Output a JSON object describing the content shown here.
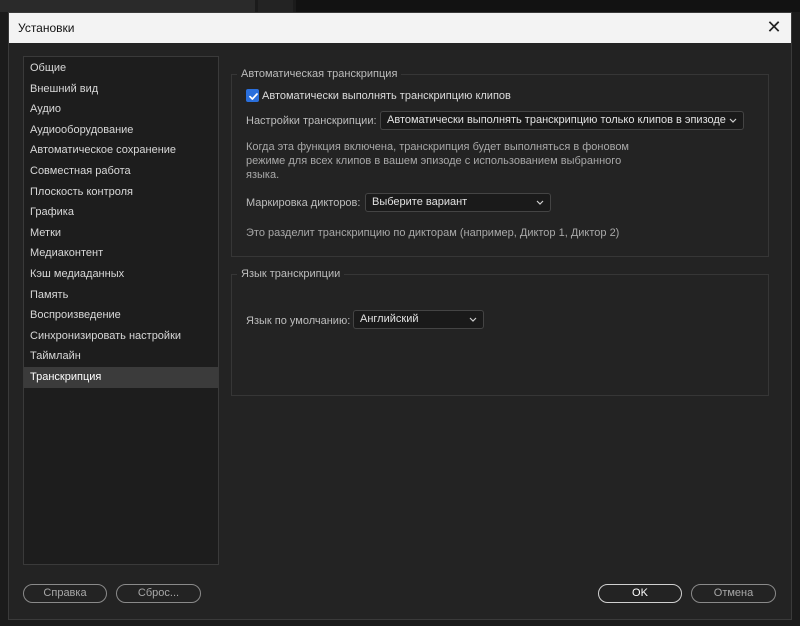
{
  "dialog": {
    "title": "Установки"
  },
  "sidebar": {
    "items": [
      {
        "label": "Общие",
        "selected": false
      },
      {
        "label": "Внешний вид",
        "selected": false
      },
      {
        "label": "Аудио",
        "selected": false
      },
      {
        "label": "Аудиооборудование",
        "selected": false
      },
      {
        "label": "Автоматическое сохранение",
        "selected": false
      },
      {
        "label": "Совместная работа",
        "selected": false
      },
      {
        "label": "Плоскость контроля",
        "selected": false
      },
      {
        "label": "Графика",
        "selected": false
      },
      {
        "label": "Метки",
        "selected": false
      },
      {
        "label": "Медиаконтент",
        "selected": false
      },
      {
        "label": "Кэш медиаданных",
        "selected": false
      },
      {
        "label": "Память",
        "selected": false
      },
      {
        "label": "Воспроизведение",
        "selected": false
      },
      {
        "label": "Синхронизировать настройки",
        "selected": false
      },
      {
        "label": "Таймлайн",
        "selected": false
      },
      {
        "label": "Транскрипция",
        "selected": true
      }
    ]
  },
  "auto_transcription": {
    "group_title": "Автоматическая транскрипция",
    "auto_checkbox_label": "Автоматически выполнять транскрипцию клипов",
    "auto_checkbox_checked": true,
    "settings_label": "Настройки транскрипции:",
    "settings_value": "Автоматически выполнять транскрипцию только клипов в эпизоде",
    "description_lines": [
      "Когда эта функция включена, транскрипция будет выполняться в фоновом",
      "режиме для всех клипов в вашем эпизоде с использованием выбранного",
      "языка."
    ],
    "speaker_label": "Маркировка дикторов:",
    "speaker_value": "Выберите вариант",
    "speaker_hint": "Это разделит транскрипцию по дикторам (например, Диктор 1, Диктор 2)"
  },
  "language": {
    "group_title": "Язык транскрипции",
    "default_label": "Язык по умолчанию:",
    "default_value": "Английский"
  },
  "buttons": {
    "help": "Справка",
    "reset": "Сброс...",
    "ok": "OK",
    "cancel": "Отмена"
  },
  "colors": {
    "accent_checkbox": "#2a6fdc",
    "dialog_bg": "#232323",
    "titlebar_bg": "#f3f3f3"
  }
}
